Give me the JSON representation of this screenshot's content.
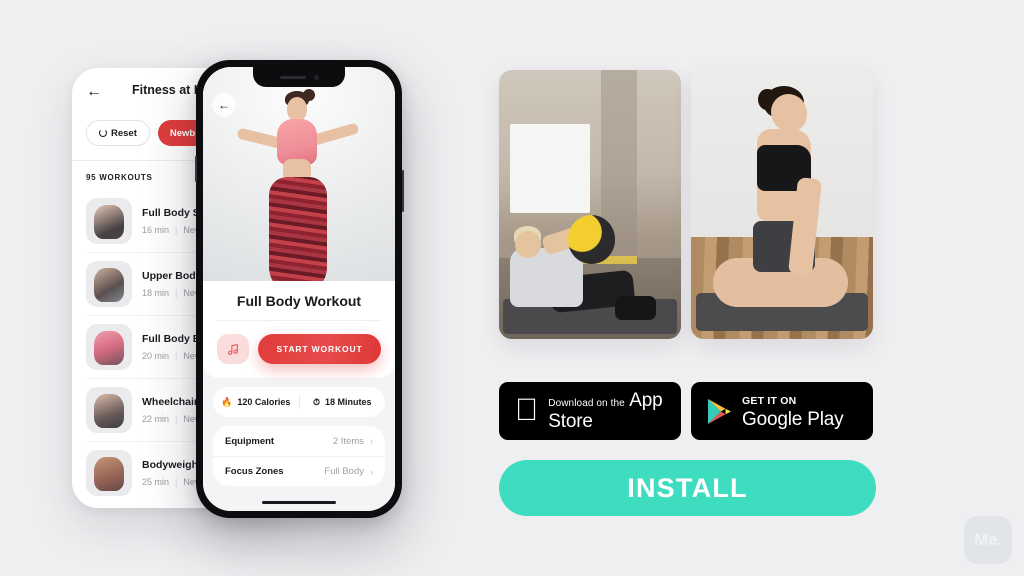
{
  "background_color": "#efeff1",
  "accent_red": "#e03c3c",
  "accent_teal": "#3fddc0",
  "back_phone": {
    "back_icon": "arrow-left-icon",
    "title": "Fitness at H",
    "filters": [
      {
        "label": "Reset",
        "icon": "reset-icon",
        "active": false
      },
      {
        "label": "Newbie",
        "active": true
      }
    ],
    "section_count": "95 WORKOUTS",
    "workouts": [
      {
        "name": "Full Body Set",
        "duration": "16 min",
        "level": "Newb"
      },
      {
        "name": "Upper Body B",
        "duration": "18 min",
        "level": "Newb"
      },
      {
        "name": "Full Body Bur",
        "duration": "20 min",
        "level": "Newb"
      },
      {
        "name": "Wheelchair C",
        "duration": "22 min",
        "level": "Newb"
      },
      {
        "name": "Bodyweight W",
        "duration": "25 min",
        "level": "Newb"
      }
    ]
  },
  "front_phone": {
    "back_icon": "arrow-left-icon",
    "hero_alt": "woman-exercising-photo",
    "title": "Full Body Workout",
    "music_icon": "music-note-icon",
    "start_label": "START WORKOUT",
    "stats": [
      {
        "icon": "flame-icon",
        "glyph": "🔥",
        "label": "120 Calories"
      },
      {
        "icon": "stopwatch-icon",
        "glyph": "⏱",
        "label": "18 Minutes"
      }
    ],
    "details": [
      {
        "label": "Equipment",
        "value": "2 Items",
        "chevron": "chevron-right-icon"
      },
      {
        "label": "Focus Zones",
        "value": "Full Body",
        "chevron": "chevron-right-icon"
      }
    ]
  },
  "photos": [
    {
      "name": "medicine-ball-workout-photo"
    },
    {
      "name": "lotus-pose-yoga-photo"
    }
  ],
  "badges": {
    "apple": {
      "logo": "apple-icon",
      "small": "Download on the",
      "big": "App Store"
    },
    "google": {
      "logo": "google-play-icon",
      "small": "GET IT ON",
      "big": "Google Play"
    }
  },
  "install_label": "INSTALL",
  "watermark": "Me."
}
